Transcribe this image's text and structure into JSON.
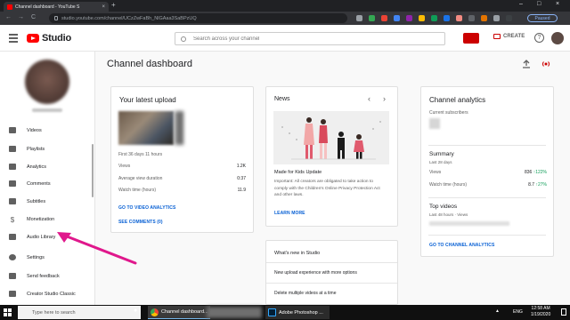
{
  "browser": {
    "tab_title": "Channel dashboard - YouTube S",
    "tab_close": "×",
    "new_tab": "+",
    "url": "studio.youtube.com/channel/UCzZwFaBh_NlGAaa3SaBPzUQ",
    "profile_status": "Paused",
    "window_controls": [
      "–",
      "□",
      "×"
    ],
    "nav_icons": [
      "←",
      "→",
      "C"
    ]
  },
  "header": {
    "logo_text": "Studio",
    "search_placeholder": "Search across your channel",
    "create_label": "CREATE",
    "help_glyph": "?"
  },
  "sidebar": {
    "items": [
      {
        "label": "Videos",
        "icon": "videos-icon"
      },
      {
        "label": "Playlists",
        "icon": "playlists-icon"
      },
      {
        "label": "Analytics",
        "icon": "analytics-icon"
      },
      {
        "label": "Comments",
        "icon": "comments-icon"
      },
      {
        "label": "Subtitles",
        "icon": "subtitles-icon"
      },
      {
        "label": "Monetization",
        "icon": "monetization-icon"
      },
      {
        "label": "Audio Library",
        "icon": "audio-library-icon"
      },
      {
        "label": "Settings",
        "icon": "settings-icon"
      },
      {
        "label": "Send feedback",
        "icon": "feedback-icon"
      },
      {
        "label": "Creator Studio Classic",
        "icon": "classic-studio-icon"
      }
    ]
  },
  "main": {
    "title": "Channel dashboard",
    "latest_upload": {
      "title": "Your latest upload",
      "period": "First 36 days 11 hours",
      "stats": [
        {
          "label": "Views",
          "value": "1.2K"
        },
        {
          "label": "Average view duration",
          "value": "0:37"
        },
        {
          "label": "Watch time (hours)",
          "value": "11.9"
        }
      ],
      "link_analytics": "GO TO VIDEO ANALYTICS",
      "link_comments": "SEE COMMENTS (0)"
    },
    "news": {
      "title": "News",
      "prev": "‹",
      "next": "›",
      "headline": "Made for Kids Update",
      "body": "Important: All creators are obligated to take action to comply with the Children's Online Privacy Protection Act and other laws.",
      "link": "LEARN MORE"
    },
    "whats_new": {
      "title": "What's new in Studio",
      "items": [
        "New upload experience with more options",
        "Delete multiple videos at a time"
      ]
    },
    "analytics": {
      "title": "Channel analytics",
      "current_subscribers_label": "Current subscribers",
      "summary_title": "Summary",
      "summary_period": "Last 28 days",
      "views_label": "Views",
      "views_value": "836",
      "views_change": "122%",
      "watch_label": "Watch time (hours)",
      "watch_value": "8.7",
      "watch_change": "27%",
      "top_videos_title": "Top videos",
      "top_videos_period": "Last 48 hours · Views",
      "link": "GO TO CHANNEL ANALYTICS"
    }
  },
  "taskbar": {
    "search_placeholder": "Type here to search",
    "tasks": [
      "Channel dashboard...",
      "Adobe Photoshop ..."
    ],
    "language": "ENG",
    "time": "12:58 AM",
    "date": "1/19/2020"
  },
  "colors": {
    "accent_red": "#ff0000",
    "link_blue": "#065fd4",
    "annotation_arrow": "#e0188c",
    "positive_green": "#0f9d58"
  }
}
